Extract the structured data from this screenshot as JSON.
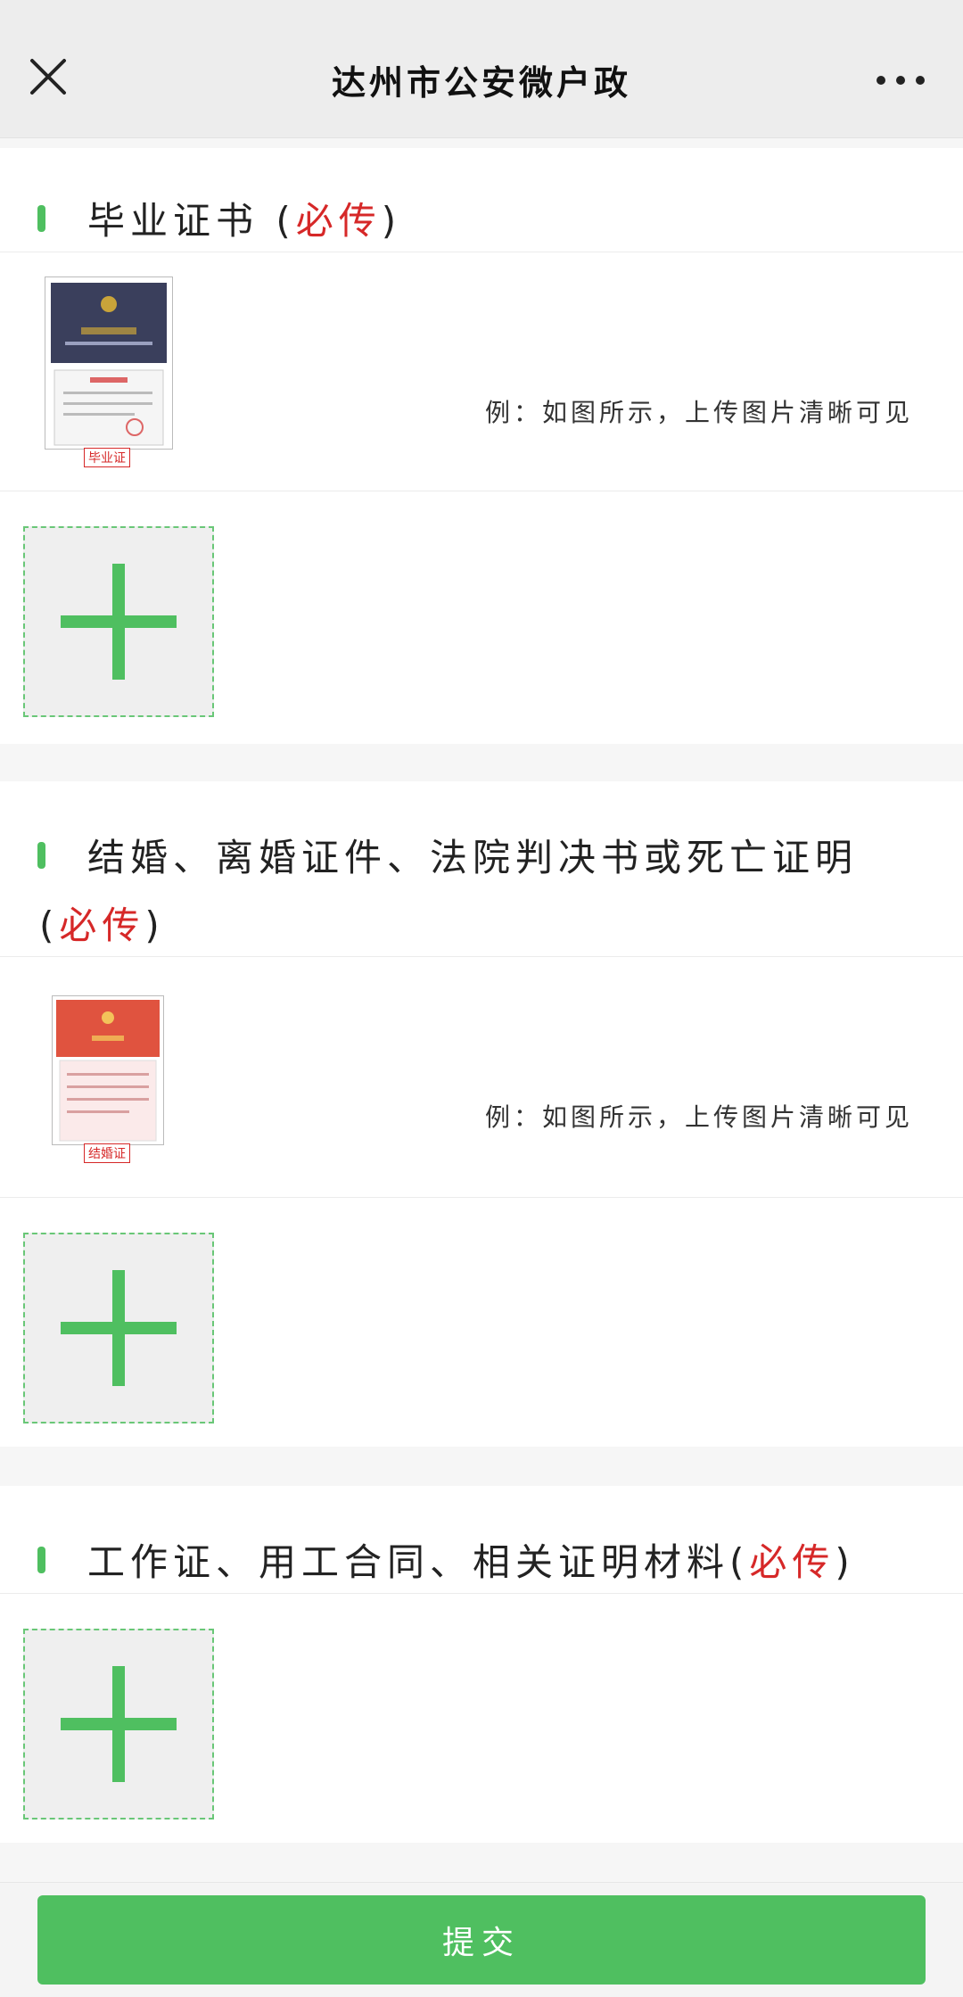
{
  "header": {
    "title": "达州市公安微户政",
    "close_icon": "close-icon",
    "more_icon": "more-dots-icon"
  },
  "sections": [
    {
      "label": "毕业证书",
      "open_paren": "(",
      "required": "必传",
      "close_paren": ")",
      "example_caption": "毕业证",
      "example_text": "例：如图所示，上传图片清晰可见"
    },
    {
      "label": "结婚、离婚证件、法院判决书或死亡证明",
      "open_paren": "(",
      "required": "必传",
      "close_paren": ")",
      "example_caption": "结婚证",
      "example_text": "例：如图所示，上传图片清晰可见"
    },
    {
      "label": "工作证、用工合同、相关证明材料",
      "open_paren": "(",
      "required": "必传",
      "close_paren": ")"
    }
  ],
  "submit": {
    "label": "提交"
  },
  "colors": {
    "accent": "#4fbf60",
    "required": "#d62828",
    "topbar": "#ededed"
  }
}
